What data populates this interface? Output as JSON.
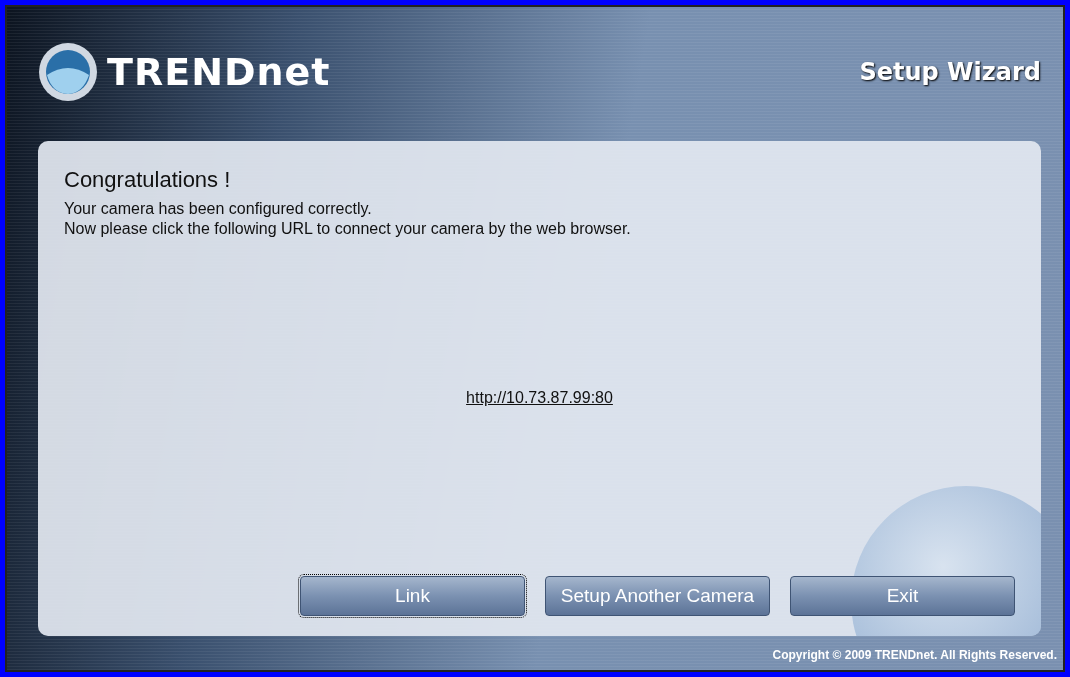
{
  "header": {
    "brand": "TRENDnet",
    "title": "Setup Wizard"
  },
  "panel": {
    "heading": "Congratulations !",
    "lines": [
      "Your camera has been configured correctly.",
      "Now please click the following URL to connect your camera by the web browser."
    ],
    "url": "http://10.73.87.99:80"
  },
  "buttons": [
    {
      "label": "Link",
      "focused": true
    },
    {
      "label": "Setup Another Camera",
      "focused": false
    },
    {
      "label": "Exit",
      "focused": false
    }
  ],
  "footer": {
    "copyright": "Copyright © 2009 TRENDnet. All Rights Reserved."
  }
}
